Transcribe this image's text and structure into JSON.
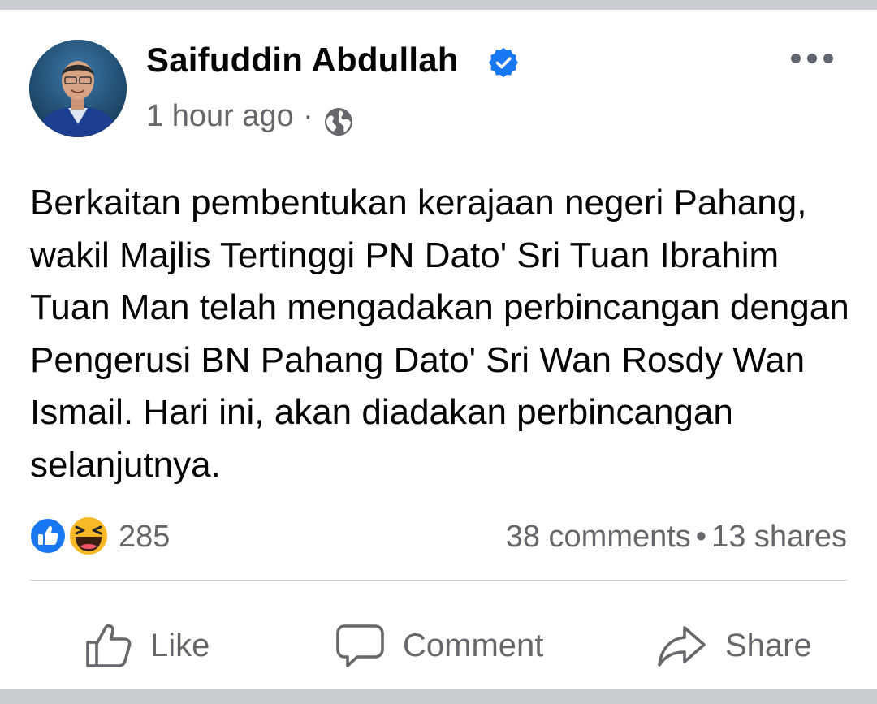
{
  "post": {
    "author": "Saifuddin Abdullah",
    "timestamp": "1 hour ago",
    "separator": "·",
    "text": "Berkaitan pembentukan kerajaan negeri Pahang, wakil Majlis Tertinggi PN Dato' Sri Tuan Ibrahim Tuan Man telah mengadakan perbincangan dengan Pengerusi BN Pahang Dato' Sri Wan Rosdy Wan Ismail. Hari ini, akan diadakan perbincangan selanjutnya."
  },
  "engagement": {
    "reaction_count": "285",
    "reactions": [
      "like-icon",
      "haha-icon"
    ],
    "comments": "38 comments",
    "bullet": "•",
    "shares": "13 shares"
  },
  "actions": {
    "like_label": "Like",
    "comment_label": "Comment",
    "share_label": "Share"
  },
  "colors": {
    "verified": "#1877f2",
    "like_reaction": "#1877f2",
    "haha_reaction": "#f7b928",
    "secondary_text": "#65676b"
  }
}
